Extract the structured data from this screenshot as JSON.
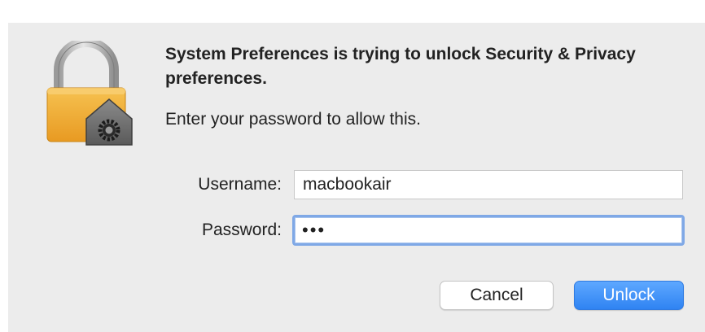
{
  "dialog": {
    "icon": "padlock-gear-icon",
    "title": "System Preferences is trying to unlock Security & Privacy preferences.",
    "message": "Enter your password to allow this.",
    "username_label": "Username:",
    "username_value": "macbookair",
    "password_label": "Password:",
    "password_value": "•••",
    "cancel_label": "Cancel",
    "unlock_label": "Unlock"
  },
  "colors": {
    "dialog_background": "#ececec",
    "accent": "#2f83f2",
    "focus_ring": "#7fa8e6",
    "lock_gold": "#f0a830"
  }
}
